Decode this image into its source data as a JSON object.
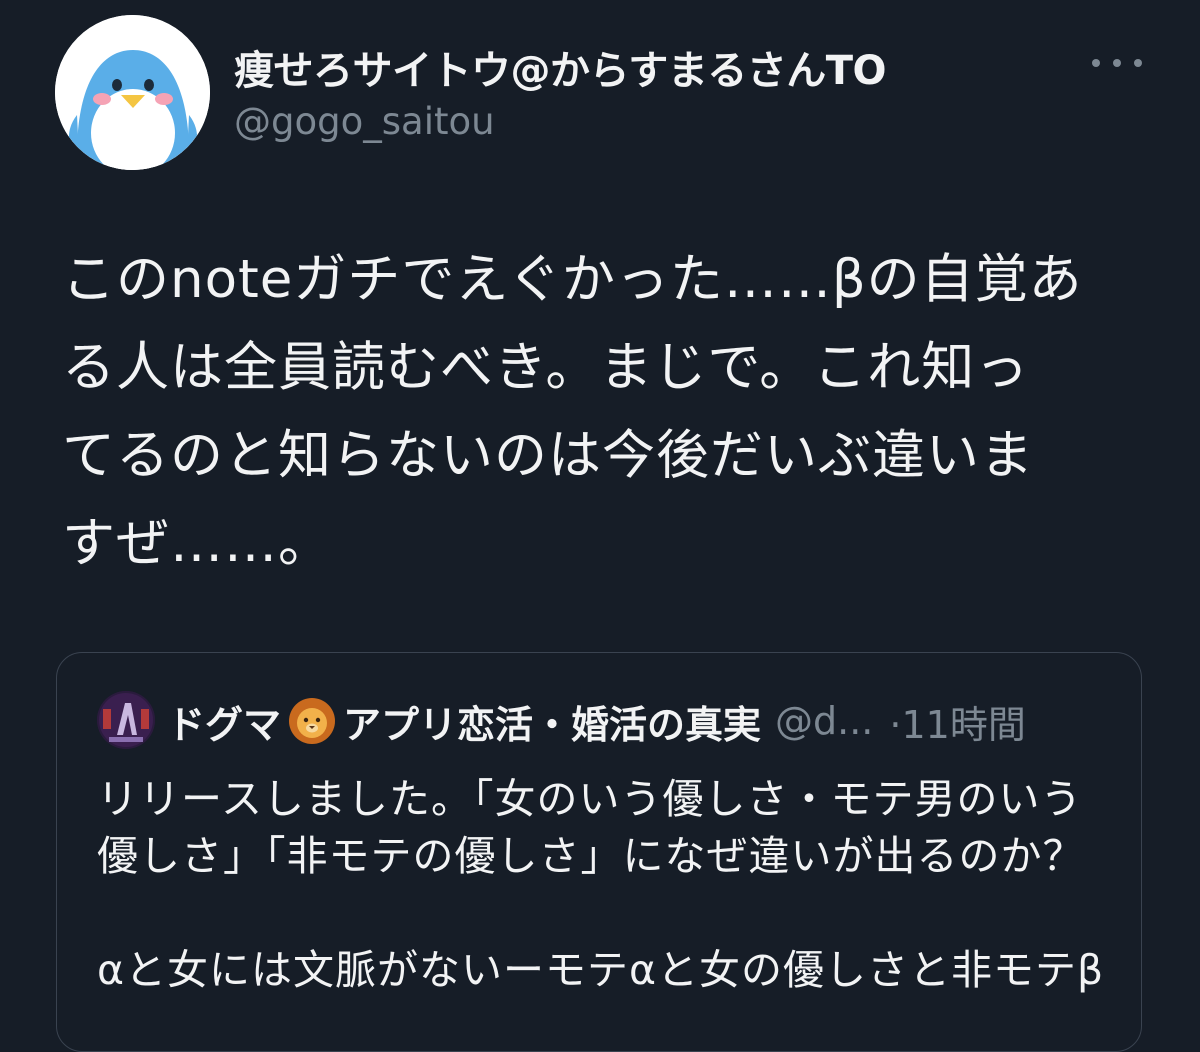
{
  "author": {
    "display_name": "痩せろサイトウ@からすまるさんTO",
    "handle": "@gogo_saitou",
    "avatar_icon": "penguin-avatar-icon"
  },
  "more_icon": "more-horizontal-icon",
  "tweet": {
    "lines": [
      "このnoteガチでえぐかった……βの自覚あ",
      "る人は全員読むべき。まじで。これ知っ",
      "てるのと知らないのは今後だいぶ違いま",
      "すぜ……。"
    ]
  },
  "quote": {
    "avatar_icon": "dogma-avatar-icon",
    "name_part1": "ドグマ",
    "emoji_icon": "lion-emoji-icon",
    "name_part2": "アプリ恋活・婚活の真実",
    "handle": "@d...",
    "time": "·11時間",
    "lines": [
      "リリースしました。「女のいう優しさ・モテ男のいう",
      "優しさ」「非モテの優しさ」になぜ違いが出るのか？",
      "",
      "αと女には文脈がないーモテαと女の優しさと非モテβ"
    ]
  },
  "colors": {
    "background": "#161d27",
    "text": "#f2f3f4",
    "muted": "#7d8893",
    "border": "#3a4350"
  }
}
